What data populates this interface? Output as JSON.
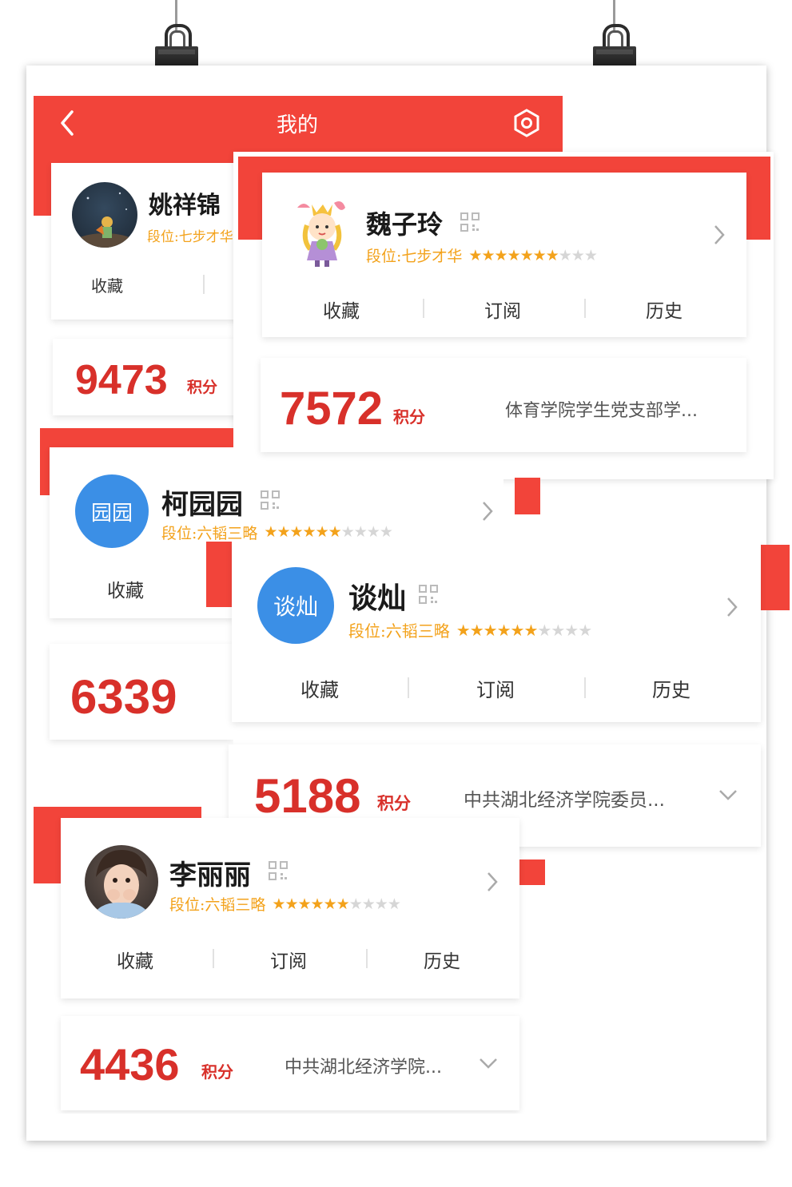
{
  "header": {
    "title": "我的",
    "back_icon": "chevron-left-icon",
    "settings_icon": "hexagon-settings-icon"
  },
  "accent_color": "#f2443a",
  "points_color": "#d8302a",
  "rank_color": "#f3a21b",
  "cards": [
    {
      "name": "姚祥锦",
      "rank": "段位:七步才华",
      "tabs": [
        "收藏"
      ],
      "points": "9473",
      "points_unit": "积分"
    },
    {
      "name": "魏子玲",
      "rank": "段位:七步才华",
      "stars_filled": 7,
      "stars_total": 10,
      "tabs": [
        "收藏",
        "订阅",
        "历史"
      ],
      "points": "7572",
      "points_unit": "积分",
      "org": "体育学院学生党支部学..."
    },
    {
      "name": "柯园园",
      "avatar_text": "园园",
      "rank": "段位:六韬三略",
      "stars_filled": 6,
      "stars_total": 10,
      "tabs": [
        "收藏"
      ],
      "points": "6339"
    },
    {
      "name": "谈灿",
      "avatar_text": "谈灿",
      "rank": "段位:六韬三略",
      "stars_filled": 6,
      "stars_total": 10,
      "tabs": [
        "收藏",
        "订阅",
        "历史"
      ],
      "points": "5188",
      "points_unit": "积分",
      "org": "中共湖北经济学院委员..."
    },
    {
      "name": "李丽丽",
      "rank": "段位:六韬三略",
      "stars_filled": 6,
      "stars_total": 10,
      "tabs": [
        "收藏",
        "订阅",
        "历史"
      ],
      "points": "4436",
      "points_unit": "积分",
      "org": "中共湖北经济学院..."
    }
  ]
}
